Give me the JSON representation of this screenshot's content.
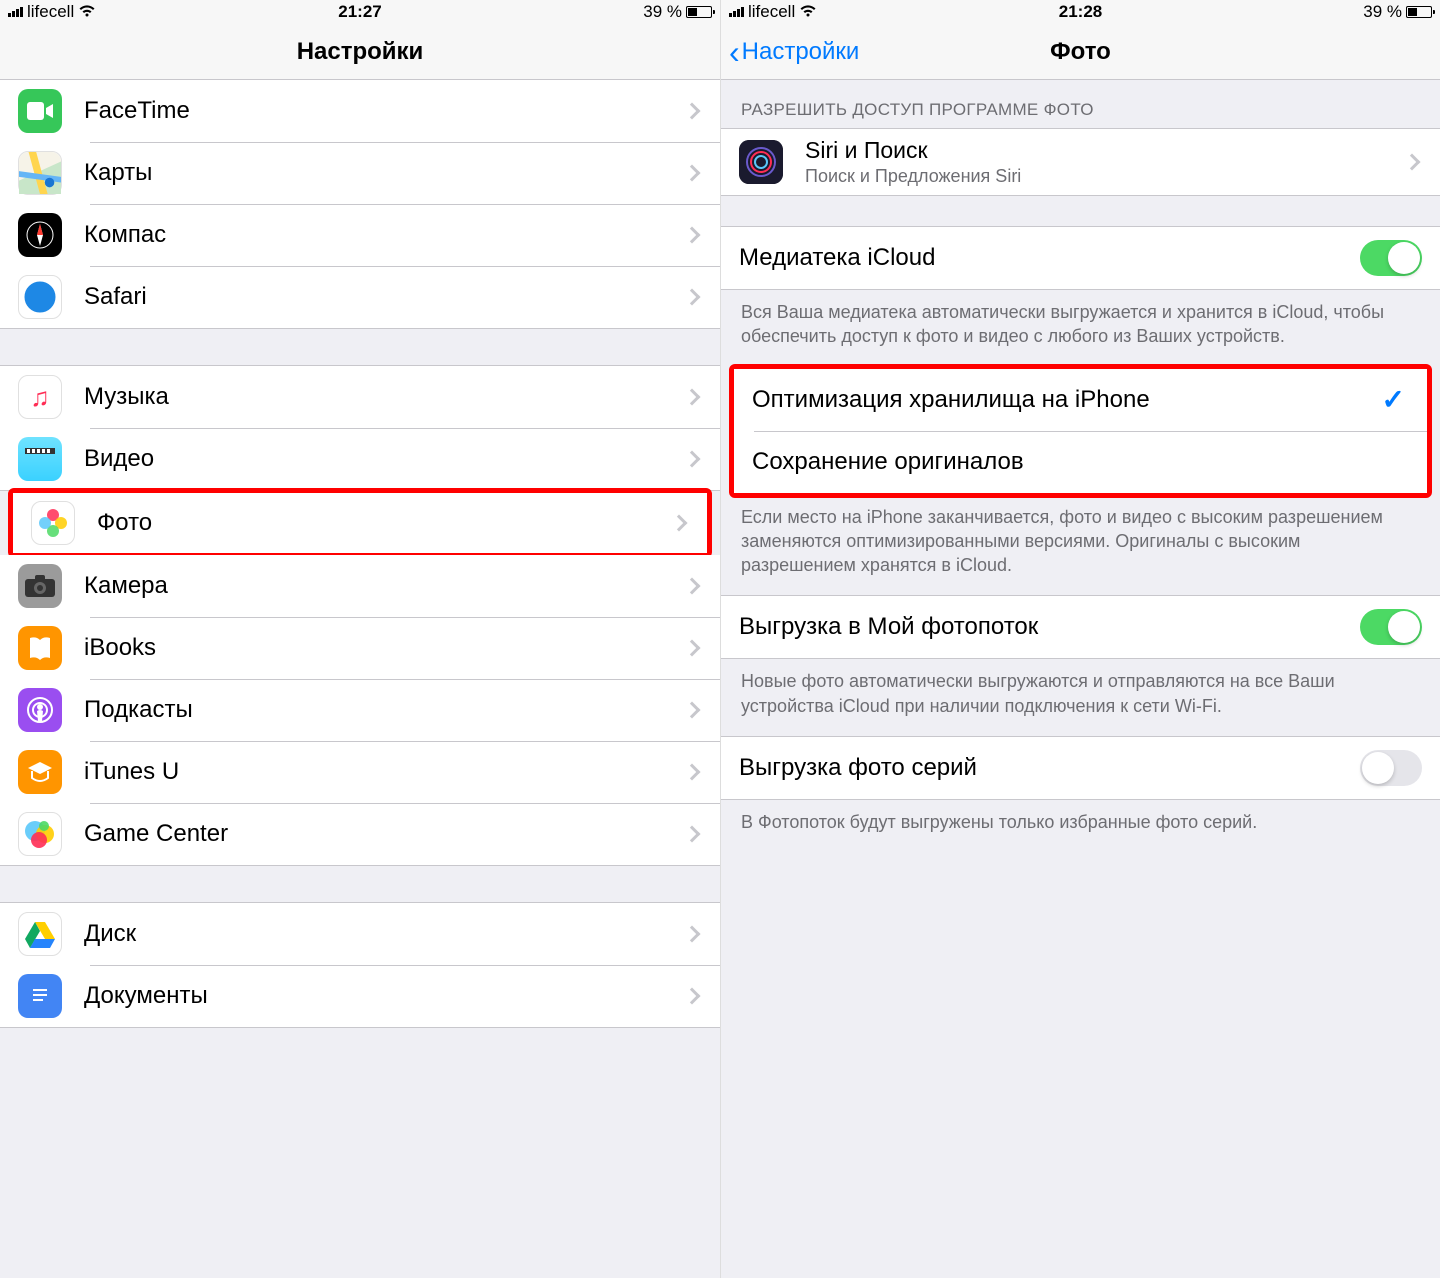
{
  "left": {
    "status": {
      "carrier": "lifecell",
      "time": "21:27",
      "battery": "39 %"
    },
    "title": "Настройки",
    "group1": [
      {
        "label": "FaceTime"
      },
      {
        "label": "Карты"
      },
      {
        "label": "Компас"
      },
      {
        "label": "Safari"
      }
    ],
    "group2": [
      {
        "label": "Музыка"
      },
      {
        "label": "Видео"
      },
      {
        "label": "Фото"
      },
      {
        "label": "Камера"
      },
      {
        "label": "iBooks"
      },
      {
        "label": "Подкасты"
      },
      {
        "label": "iTunes U"
      },
      {
        "label": "Game Center"
      }
    ],
    "group3": [
      {
        "label": "Диск"
      },
      {
        "label": "Документы"
      }
    ]
  },
  "right": {
    "status": {
      "carrier": "lifecell",
      "time": "21:28",
      "battery": "39 %"
    },
    "back": "Настройки",
    "title": "Фото",
    "sectionAllow": "РАЗРЕШИТЬ ДОСТУП ПРОГРАММЕ ФОТО",
    "siri": {
      "title": "Siri и Поиск",
      "subtitle": "Поиск и Предложения Siri"
    },
    "icloudLibrary": "Медиатека iCloud",
    "icloudFooter": "Вся Ваша медиатека автоматически выгружается и хранится в iCloud, чтобы обеспечить доступ к фото и видео с любого из Ваших устройств.",
    "optimize": "Оптимизация хранилища на iPhone",
    "keepOriginals": "Сохранение оригиналов",
    "storageFooter": "Если место на iPhone заканчивается, фото и видео с высоким разрешением заменяются оптимизированными версиями. Оригиналы с высоким разрешением хранятся в iCloud.",
    "photoStream": "Выгрузка в Мой фотопоток",
    "photoStreamFooter": "Новые фото автоматически выгружаются и отправляются на все Ваши устройства iCloud при наличии подключения к сети Wi-Fi.",
    "burstUpload": "Выгрузка фото серий",
    "burstFooter": "В Фотопоток будут выгружены только избранные фото серий."
  }
}
